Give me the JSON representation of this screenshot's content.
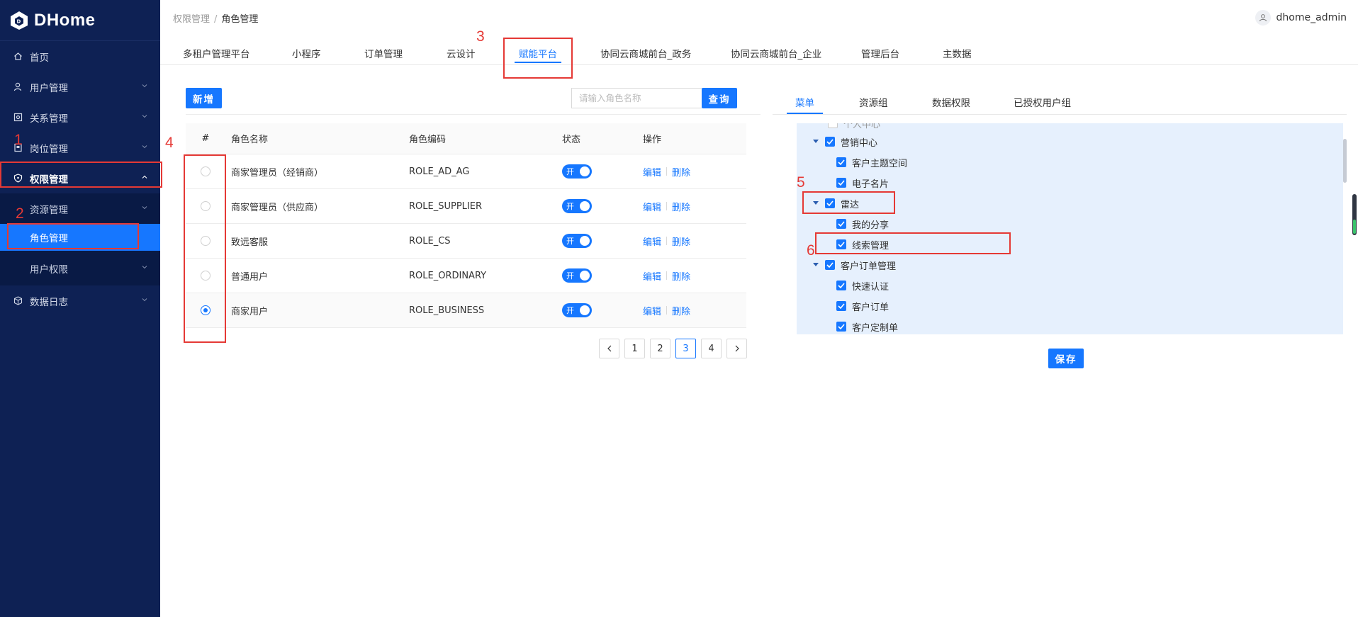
{
  "app": {
    "logo_text": "DHome",
    "username": "dhome_admin",
    "accent_color": "#1677ff",
    "sidebar_color": "#0e2154"
  },
  "sidebar": {
    "items": [
      {
        "label": "首页",
        "icon": "home-icon"
      },
      {
        "label": "用户管理",
        "icon": "user-icon"
      },
      {
        "label": "关系管理",
        "icon": "relation-icon"
      },
      {
        "label": "岗位管理",
        "icon": "post-icon"
      },
      {
        "label": "权限管理",
        "icon": "shield-icon"
      },
      {
        "label": "资源管理"
      },
      {
        "label": "角色管理"
      },
      {
        "label": "用户权限"
      },
      {
        "label": "数据日志",
        "icon": "cube-icon"
      }
    ]
  },
  "breadcrumb": {
    "parent": "权限管理",
    "separator": "/",
    "current": "角色管理"
  },
  "top_tabs": [
    "多租户管理平台",
    "小程序",
    "订单管理",
    "云设计",
    "赋能平台",
    "协同云商城前台_政务",
    "协同云商城前台_企业",
    "管理后台",
    "主数据"
  ],
  "left": {
    "add_label": "新增",
    "search_placeholder": "请输入角色名称",
    "search_button": "查询",
    "columns": [
      "#",
      "角色名称",
      "角色编码",
      "状态",
      "操作"
    ],
    "rows": [
      {
        "name": "商家管理员（经销商）",
        "code": "ROLE_AD_AG",
        "status": "开",
        "selected": false
      },
      {
        "name": "商家管理员（供应商）",
        "code": "ROLE_SUPPLIER",
        "status": "开",
        "selected": false
      },
      {
        "name": "致远客服",
        "code": "ROLE_CS",
        "status": "开",
        "selected": false
      },
      {
        "name": "普通用户",
        "code": "ROLE_ORDINARY",
        "status": "开",
        "selected": false
      },
      {
        "name": "商家用户",
        "code": "ROLE_BUSINESS",
        "status": "开",
        "selected": true
      }
    ],
    "edit_label": "编辑",
    "delete_label": "删除",
    "pages": [
      "1",
      "2",
      "3",
      "4"
    ],
    "current_page": "3"
  },
  "right": {
    "tabs": [
      "菜单",
      "资源组",
      "数据权限",
      "已授权用户组"
    ],
    "tree": {
      "partial_label": "个人中心",
      "marketing": "营销中心",
      "customer_space": "客户主题空间",
      "ecard": "电子名片",
      "radar": "雷达",
      "my_share": "我的分享",
      "leads": "线索管理",
      "customer_order_mgmt": "客户订单管理",
      "quick_auth": "快速认证",
      "customer_order": "客户订单",
      "custom_order": "客户定制单"
    },
    "save_label": "保存"
  },
  "annotations": [
    "1",
    "2",
    "3",
    "4",
    "5",
    "6"
  ]
}
